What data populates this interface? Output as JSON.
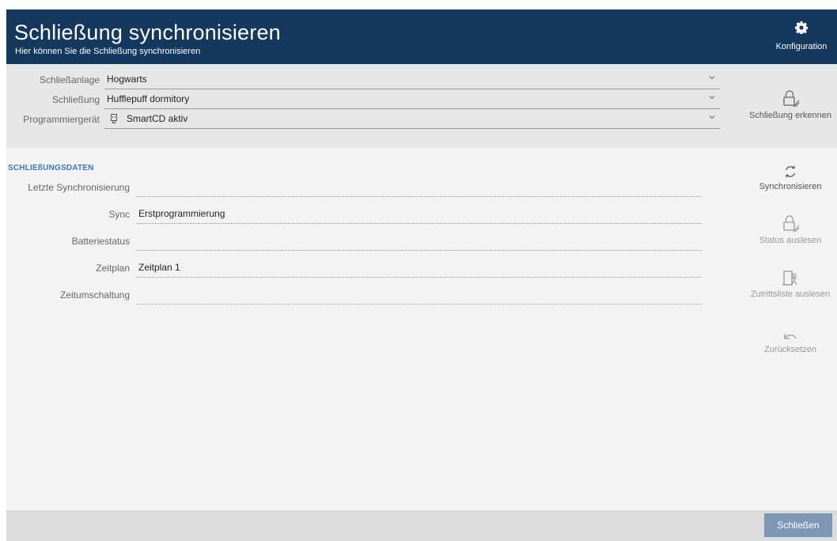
{
  "header": {
    "title": "Schließung synchronisieren",
    "subtitle": "Hier können Sie die Schließung synchronisieren",
    "config_label": "Konfiguration",
    "config_icon": "gear-icon"
  },
  "selection": {
    "schliessanlage": {
      "label": "Schließanlage",
      "value": "Hogwarts"
    },
    "schliessung": {
      "label": "Schließung",
      "value": "Hufflepuff dormitory"
    },
    "programmiergeraet": {
      "label": "Programmiergerät",
      "value": "SmartCD aktiv",
      "icon": "usb-device-icon"
    }
  },
  "details": {
    "section_title": "SCHLIEßUNGSDATEN",
    "fields": [
      {
        "label": "Letzte Synchronisierung",
        "value": ""
      },
      {
        "label": "Sync",
        "value": "Erstprogrammierung"
      },
      {
        "label": "Batteriestatus",
        "value": ""
      },
      {
        "label": "Zeitplan",
        "value": "Zeitplan 1"
      },
      {
        "label": "Zeitumschaltung",
        "value": ""
      }
    ]
  },
  "actions": {
    "recognize": {
      "label": "Schließung erkennen",
      "enabled": true,
      "icon": "lock-wireless-icon"
    },
    "sync": {
      "label": "Synchronisieren",
      "enabled": true,
      "icon": "sync-icon"
    },
    "read_status": {
      "label": "Status auslesen",
      "enabled": false,
      "icon": "lock-wireless-icon"
    },
    "read_access_list": {
      "label": "Zutrittsliste auslesen",
      "enabled": false,
      "icon": "door-person-icon"
    },
    "reset": {
      "label": "Zurücksetzen",
      "enabled": false,
      "icon": "undo-icon"
    }
  },
  "footer": {
    "close_label": "Schließen"
  },
  "colors": {
    "header_bg": "#14385e",
    "accent": "#3e78b4",
    "close_button": "#7e97b4"
  }
}
